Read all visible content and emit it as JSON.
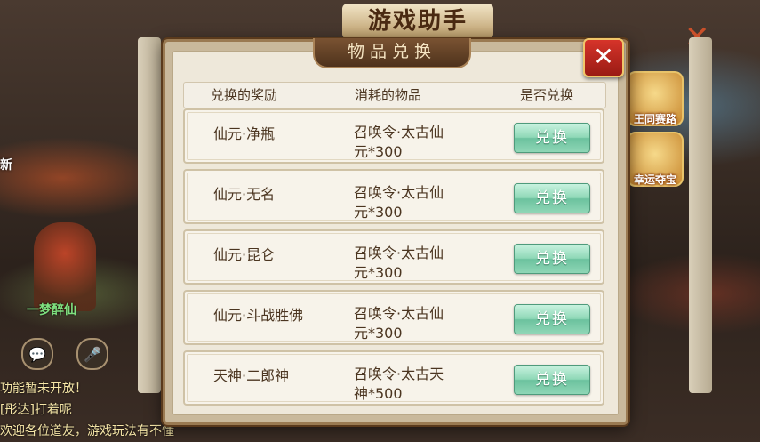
{
  "background": {
    "game_title": "游戏助手",
    "side_badge": "新",
    "player_name": "一梦醉仙",
    "event_icons": [
      {
        "label": "王同赛路"
      },
      {
        "label": "幸运夺宝"
      }
    ],
    "chat_lines": [
      "功能暂未开放！",
      "[彤达]打着呢",
      "欢迎各位道友，游戏玩法有不懂"
    ]
  },
  "dialog": {
    "title": "物品兑换",
    "close_glyph": "✕",
    "columns": {
      "reward": "兑换的奖励",
      "cost": "消耗的物品",
      "exchange": "是否兑换"
    },
    "rows": [
      {
        "reward": "仙元·净瓶",
        "cost_line1": "召唤令·太古仙",
        "cost_line2": "元*300",
        "button": "兑换"
      },
      {
        "reward": "仙元·无名",
        "cost_line1": "召唤令·太古仙",
        "cost_line2": "元*300",
        "button": "兑换"
      },
      {
        "reward": "仙元·昆仑",
        "cost_line1": "召唤令·太古仙",
        "cost_line2": "元*300",
        "button": "兑换"
      },
      {
        "reward": "仙元·斗战胜佛",
        "cost_line1": "召唤令·太古仙",
        "cost_line2": "元*300",
        "button": "兑换"
      },
      {
        "reward": "天神·二郎神",
        "cost_line1": "召唤令·太古天",
        "cost_line2": "神*500",
        "button": "兑换"
      }
    ]
  },
  "colors": {
    "dialog_frame": "#c9b99c",
    "title_tab": "#5e3d22",
    "close_button": "#c42a22",
    "exchange_button": "#8fd8b7",
    "text": "#4b3520"
  }
}
